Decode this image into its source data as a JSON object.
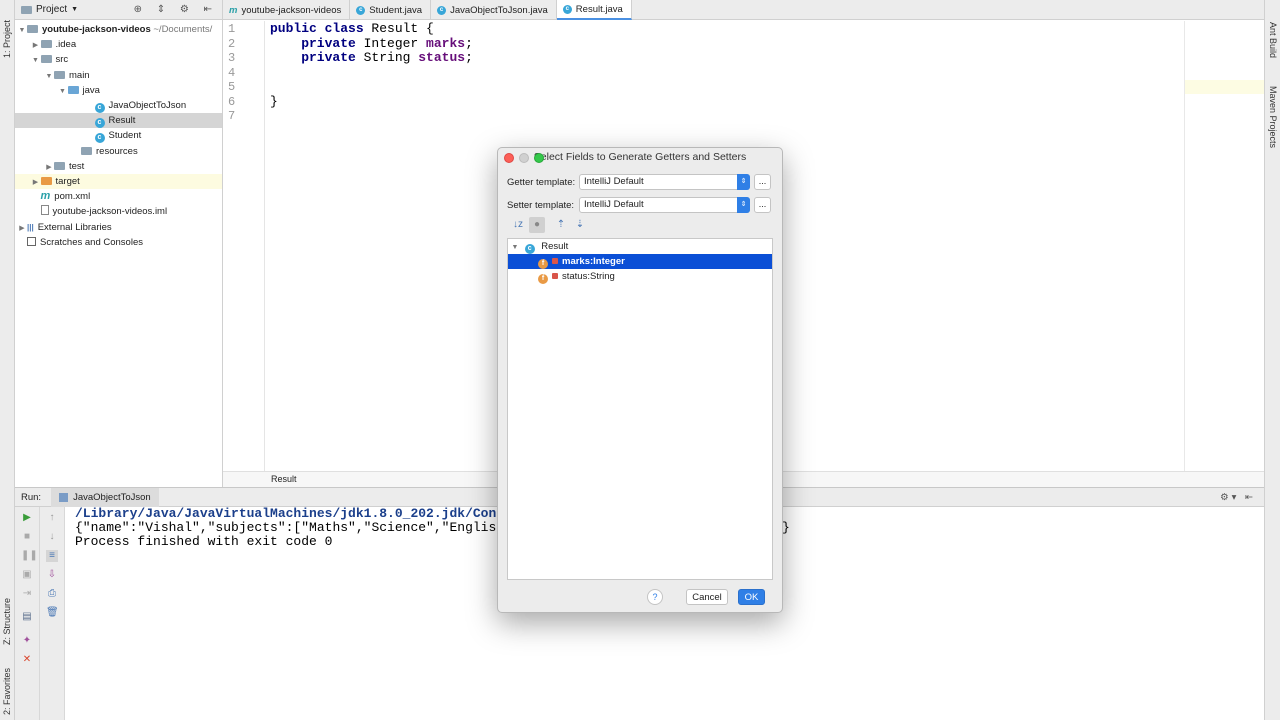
{
  "left_stripe": {
    "project_label": "1: Project",
    "structure_label": "Z: Structure",
    "favorites_label": "2: Favorites"
  },
  "right_stripe": {
    "ant_label": "Ant Build",
    "maven_label": "Maven Projects"
  },
  "project_panel": {
    "title": "Project",
    "tree": [
      {
        "label": "youtube-jackson-videos",
        "suffix": " ~/Documents/",
        "depth": 0,
        "arrow": "▼",
        "icon": "folder"
      },
      {
        "label": ".idea",
        "depth": 1,
        "arrow": "▶",
        "icon": "folder"
      },
      {
        "label": "src",
        "depth": 1,
        "arrow": "▼",
        "icon": "folder"
      },
      {
        "label": "main",
        "depth": 2,
        "arrow": "▼",
        "icon": "folder"
      },
      {
        "label": "java",
        "depth": 3,
        "arrow": "▼",
        "icon": "folder-blue"
      },
      {
        "label": "JavaObjectToJson",
        "depth": 5,
        "arrow": "",
        "icon": "class"
      },
      {
        "label": "Result",
        "depth": 5,
        "arrow": "",
        "icon": "class",
        "selected": true
      },
      {
        "label": "Student",
        "depth": 5,
        "arrow": "",
        "icon": "class"
      },
      {
        "label": "resources",
        "depth": 4,
        "arrow": "",
        "icon": "folder"
      },
      {
        "label": "test",
        "depth": 2,
        "arrow": "▶",
        "icon": "folder"
      },
      {
        "label": "target",
        "depth": 1,
        "arrow": "▶",
        "icon": "folder-orange",
        "highlight": true
      },
      {
        "label": "pom.xml",
        "depth": 1,
        "arrow": "",
        "icon": "maven"
      },
      {
        "label": "youtube-jackson-videos.iml",
        "depth": 1,
        "arrow": "",
        "icon": "file"
      },
      {
        "label": "External Libraries",
        "depth": 0,
        "arrow": "▶",
        "icon": "library"
      },
      {
        "label": "Scratches and Consoles",
        "depth": 0,
        "arrow": "",
        "icon": "scratch"
      }
    ]
  },
  "tabs": [
    {
      "label": "youtube-jackson-videos",
      "icon": "m"
    },
    {
      "label": "Student.java",
      "icon": "c"
    },
    {
      "label": "JavaObjectToJson.java",
      "icon": "c"
    },
    {
      "label": "Result.java",
      "icon": "c",
      "active": true
    }
  ],
  "editor": {
    "line_numbers": [
      "1",
      "2",
      "3",
      "4",
      "5",
      "6",
      "7"
    ],
    "lines": [
      {
        "kw": "public class",
        "rest": " Result {"
      },
      {
        "kw": "    private",
        "rest": " Integer ",
        "field": "marks",
        "end": ";"
      },
      {
        "kw": "    private",
        "rest": " String ",
        "field": "status",
        "end": ";"
      },
      {
        "kw": "",
        "rest": ""
      },
      {
        "kw": "",
        "rest": ""
      },
      {
        "kw": "",
        "rest": "}"
      },
      {
        "kw": "",
        "rest": ""
      }
    ],
    "breadcrumb": "Result"
  },
  "run_panel": {
    "run_label": "Run:",
    "config_tab": "JavaObjectToJson",
    "console": [
      "/Library/Java/JavaVirtualMachines/jdk1.8.0_202.jdk/Conte",
      "{\"name\":\"Vishal\",\"subjects\":[\"Maths\",\"Science\",\"English\"",
      "Process finished with exit code 0"
    ],
    "console_tail": "}"
  },
  "dialog": {
    "title": "Select Fields to Generate Getters and Setters",
    "getter_label": "Getter template:",
    "getter_value": "IntelliJ Default",
    "setter_label": "Setter template:",
    "setter_value": "IntelliJ Default",
    "more_label": "...",
    "root_class": "Result",
    "fields": [
      {
        "label": "marks:Integer",
        "selected": true
      },
      {
        "label": "status:String",
        "selected": false
      }
    ],
    "help_label": "?",
    "cancel_label": "Cancel",
    "ok_label": "OK"
  },
  "colors": {
    "accent": "#2f7fe6",
    "selection": "#0b4fd6",
    "keyword": "#000080",
    "field": "#660e7a",
    "console_path": "#1b3f8b"
  }
}
